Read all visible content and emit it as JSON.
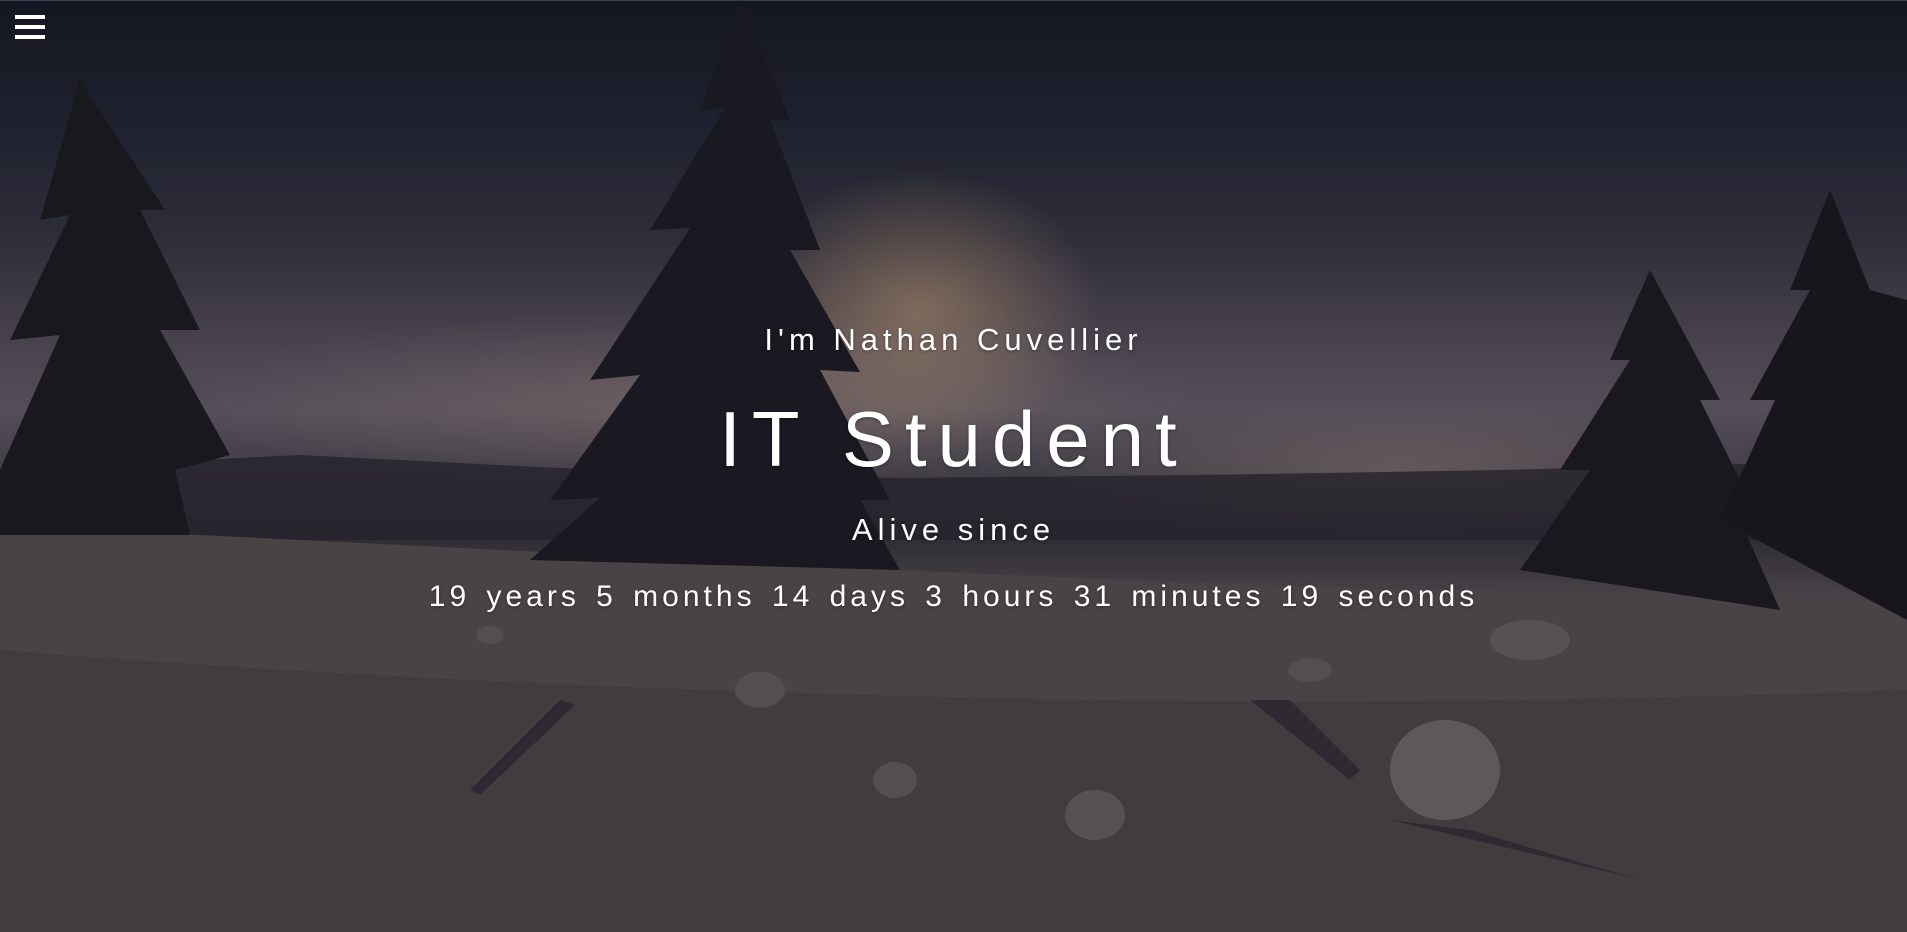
{
  "nav": {
    "menu_icon": "hamburger-menu-icon"
  },
  "hero": {
    "intro": "I'm Nathan Cuvellier",
    "role": "IT Student",
    "alive_label": "Alive since",
    "age_counter": "19 years 5 months 14 days 3 hours 31 minutes 19 seconds"
  },
  "colors": {
    "text": "#ffffff",
    "sky_dark": "#171b26",
    "sun_glow": "#ebbe8c",
    "snow": "#6a6264"
  }
}
